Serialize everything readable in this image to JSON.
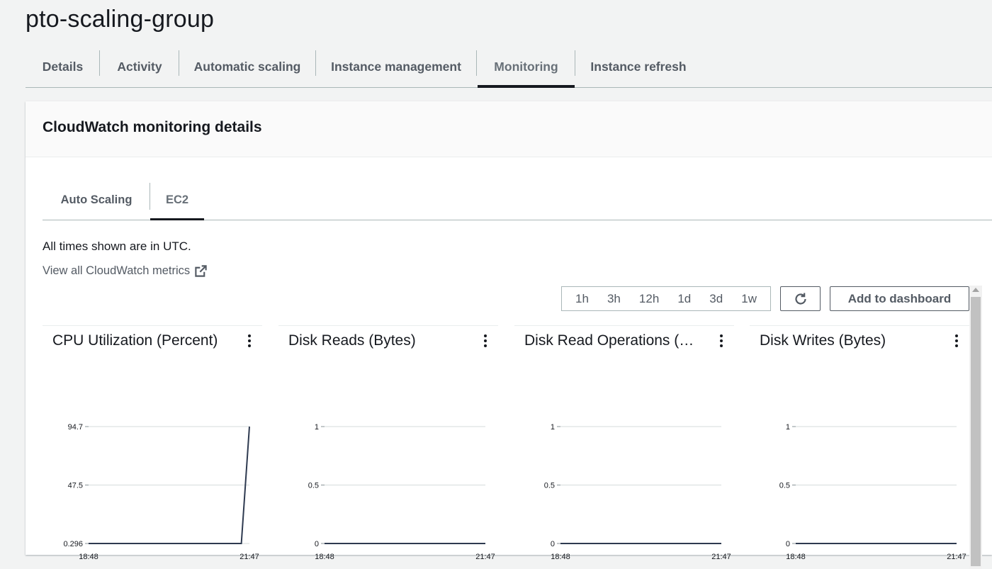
{
  "page": {
    "title": "pto-scaling-group"
  },
  "tabs": [
    {
      "label": "Details",
      "active": false
    },
    {
      "label": "Activity",
      "active": false
    },
    {
      "label": "Automatic scaling",
      "active": false
    },
    {
      "label": "Instance management",
      "active": false
    },
    {
      "label": "Monitoring",
      "active": true
    },
    {
      "label": "Instance refresh",
      "active": false
    }
  ],
  "panel": {
    "title": "CloudWatch monitoring details",
    "subtabs": [
      {
        "label": "Auto Scaling",
        "active": false
      },
      {
        "label": "EC2",
        "active": true
      }
    ],
    "utc_note": "All times shown are in UTC.",
    "cloudwatch_link": "View all CloudWatch metrics",
    "time_ranges": [
      "1h",
      "3h",
      "12h",
      "1d",
      "3d",
      "1w"
    ],
    "add_to_dashboard": "Add to dashboard"
  },
  "colors": {
    "line": "#2e3a50",
    "grid": "#d5dbdb"
  },
  "chart_data": [
    {
      "type": "line",
      "title": "CPU Utilization (Percent)",
      "y_ticks": [
        "94.7",
        "47.5",
        "0.296"
      ],
      "ylim": [
        0.296,
        94.7
      ],
      "x_ticks": [
        "18:48",
        "21:47"
      ],
      "series": [
        {
          "x": [
            "18:48",
            "21:38",
            "21:47"
          ],
          "y": [
            0.296,
            0.296,
            94.7
          ]
        }
      ]
    },
    {
      "type": "line",
      "title": "Disk Reads (Bytes)",
      "y_ticks": [
        "1",
        "0.5",
        "0"
      ],
      "ylim": [
        0,
        1
      ],
      "x_ticks": [
        "18:48",
        "21:47"
      ],
      "series": [
        {
          "x": [
            "18:48",
            "21:47"
          ],
          "y": [
            0,
            0
          ]
        }
      ]
    },
    {
      "type": "line",
      "title": "Disk Read Operations (O…",
      "y_ticks": [
        "1",
        "0.5",
        "0"
      ],
      "ylim": [
        0,
        1
      ],
      "x_ticks": [
        "18:48",
        "21:47"
      ],
      "series": [
        {
          "x": [
            "18:48",
            "21:47"
          ],
          "y": [
            0,
            0
          ]
        }
      ]
    },
    {
      "type": "line",
      "title": "Disk Writes (Bytes)",
      "y_ticks": [
        "1",
        "0.5",
        "0"
      ],
      "ylim": [
        0,
        1
      ],
      "x_ticks": [
        "18:48",
        "21:47"
      ],
      "series": [
        {
          "x": [
            "18:48",
            "21:47"
          ],
          "y": [
            0,
            0
          ]
        }
      ]
    }
  ]
}
